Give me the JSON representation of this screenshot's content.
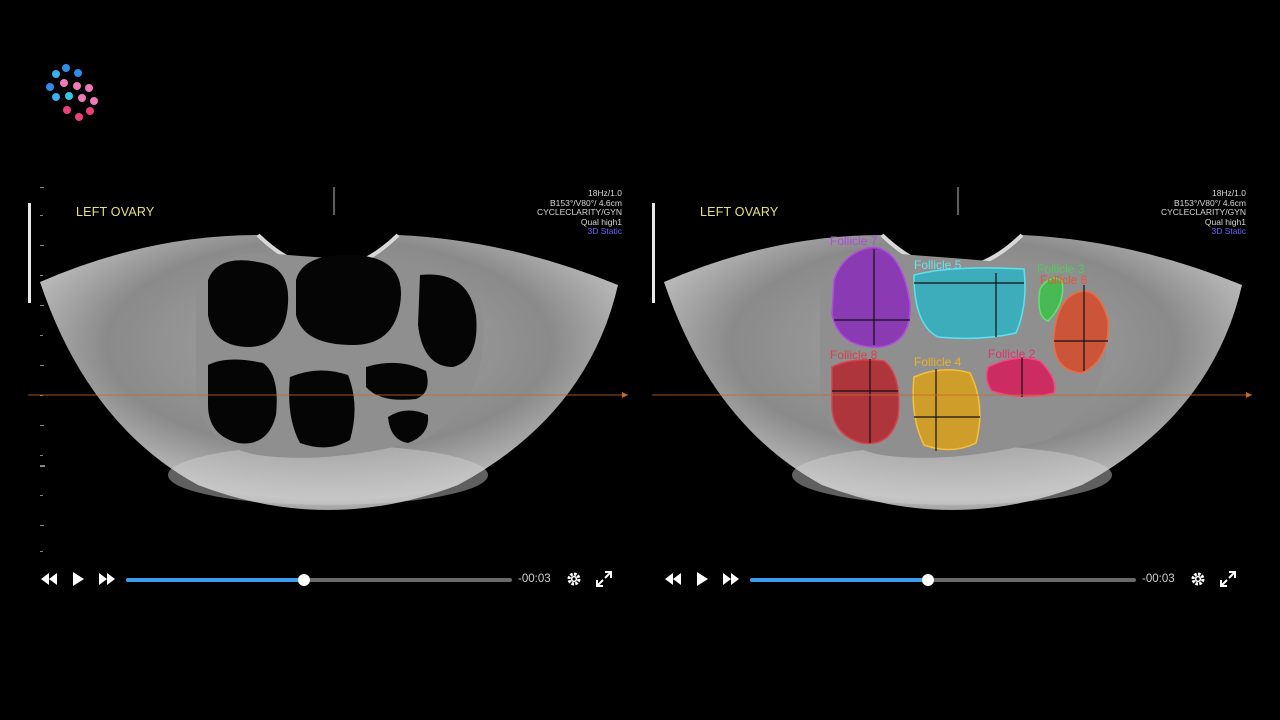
{
  "app": {
    "logo_icon": "dotted-flower-logo"
  },
  "players": [
    {
      "id": "original",
      "header_label": "LEFT OVARY",
      "info_lines": [
        "18Hz/1.0",
        "B153°/V80°/ 4.6cm",
        "CYCLECLARITY/GYN",
        "Qual high1"
      ],
      "mode": "3D Static",
      "progress": 0.46,
      "time": "-00:03",
      "controls": [
        "rewind-icon",
        "play-icon",
        "fast-forward-icon",
        "gear-icon",
        "fullscreen-icon"
      ]
    },
    {
      "id": "segmented",
      "header_label": "LEFT OVARY",
      "info_lines": [
        "18Hz/1.0",
        "B153°/V80°/ 4.6cm",
        "CYCLECLARITY/GYN",
        "Qual high1"
      ],
      "mode": "3D Static",
      "progress": 0.46,
      "time": "-00:03",
      "controls": [
        "rewind-icon",
        "play-icon",
        "fast-forward-icon",
        "gear-icon",
        "fullscreen-icon"
      ],
      "follicles": [
        {
          "label": "Follicle 7",
          "color": "#8a2bb8"
        },
        {
          "label": "Follicle 5",
          "color": "#2fb3c4"
        },
        {
          "label": "Follicle 3",
          "color": "#3cc24a"
        },
        {
          "label": "Follicle 6",
          "color": "#d64a2a"
        },
        {
          "label": "Follicle 8",
          "color": "#b5262f"
        },
        {
          "label": "Follicle 4",
          "color": "#d9a019"
        },
        {
          "label": "Follicle 2",
          "color": "#d81b5c"
        }
      ]
    }
  ]
}
